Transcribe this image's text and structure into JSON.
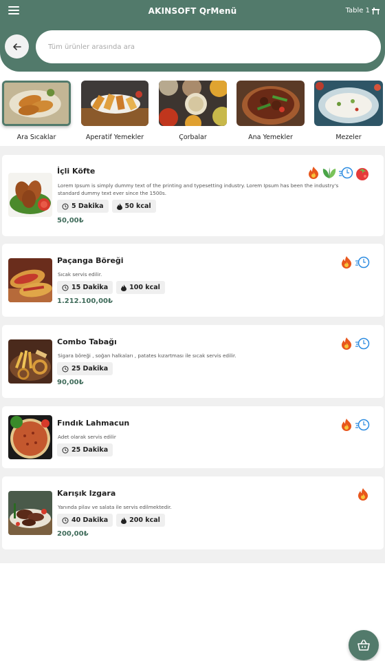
{
  "header": {
    "title": "AKINSOFT QrMenü",
    "table_label": "Table 1",
    "search_placeholder": "Tüm ürünler arasında ara",
    "brand_color": "#527a6b"
  },
  "categories": [
    {
      "label": "Ara Sıcaklar",
      "active": true
    },
    {
      "label": "Aperatif Yemekler",
      "active": false
    },
    {
      "label": "Çorbalar",
      "active": false
    },
    {
      "label": "Ana Yemekler",
      "active": false
    },
    {
      "label": "Mezeler",
      "active": false
    }
  ],
  "products": [
    {
      "name": "İçli Köfte",
      "description": "Lorem Ipsum is simply dummy text of the printing and typesetting industry. Lorem Ipsum has been the industry's standard dummy text ever since the 1500s.",
      "time": "5 Dakika",
      "calories": "50 kcal",
      "price": "50,00₺",
      "icons": [
        "spicy-icon",
        "vegan-icon",
        "fast-service-icon",
        "tomato-icon"
      ]
    },
    {
      "name": "Paçanga Böreği",
      "description": "Sıcak servis edilir.",
      "time": "15 Dakika",
      "calories": "100 kcal",
      "price": "1.212.100,00₺",
      "icons": [
        "spicy-icon",
        "fast-service-icon"
      ]
    },
    {
      "name": "Combo Tabağı",
      "description": "Sigara böreği , soğan halkaları , patates kızartması ile sıcak servis edilir.",
      "time": "25 Dakika",
      "price": "90,00₺",
      "icons": [
        "spicy-icon",
        "fast-service-icon"
      ]
    },
    {
      "name": "Fındık Lahmacun",
      "description": "Adet olarak servis edilir",
      "time": "25 Dakika",
      "icons": [
        "spicy-icon",
        "fast-service-icon"
      ]
    },
    {
      "name": "Karışık Izgara",
      "description": "Yanında pilav ve salata ile servis edilmektedir.",
      "time": "40 Dakika",
      "calories": "200 kcal",
      "price": "200,00₺",
      "icons": [
        "spicy-icon"
      ]
    }
  ]
}
